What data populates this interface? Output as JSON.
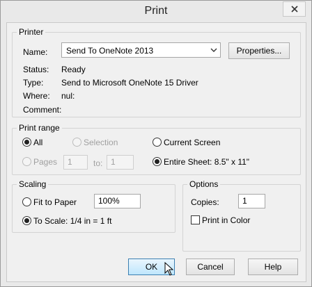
{
  "window": {
    "title": "Print"
  },
  "printer": {
    "legend": "Printer",
    "name_label": "Name:",
    "name_value": "Send To OneNote 2013",
    "properties_label": "Properties...",
    "status_label": "Status:",
    "status_value": "Ready",
    "type_label": "Type:",
    "type_value": "Send to Microsoft OneNote 15 Driver",
    "where_label": "Where:",
    "where_value": "nul:",
    "comment_label": "Comment:",
    "comment_value": ""
  },
  "print_range": {
    "legend": "Print range",
    "all_label": "All",
    "selection_label": "Selection",
    "current_screen_label": "Current Screen",
    "pages_label": "Pages",
    "pages_from": "1",
    "to_label": "to:",
    "pages_to": "1",
    "entire_sheet_label": "Entire Sheet: 8.5\" x 11\"",
    "selected": "All + Entire Sheet"
  },
  "scaling": {
    "legend": "Scaling",
    "fit_label": "Fit to Paper",
    "fit_value": "100%",
    "to_scale_label": "To Scale: 1/4 in = 1 ft",
    "selected": "To Scale"
  },
  "options": {
    "legend": "Options",
    "copies_label": "Copies:",
    "copies_value": "1",
    "print_in_color_label": "Print in Color",
    "print_in_color_checked": false
  },
  "buttons": {
    "ok": "OK",
    "cancel": "Cancel",
    "help": "Help"
  }
}
